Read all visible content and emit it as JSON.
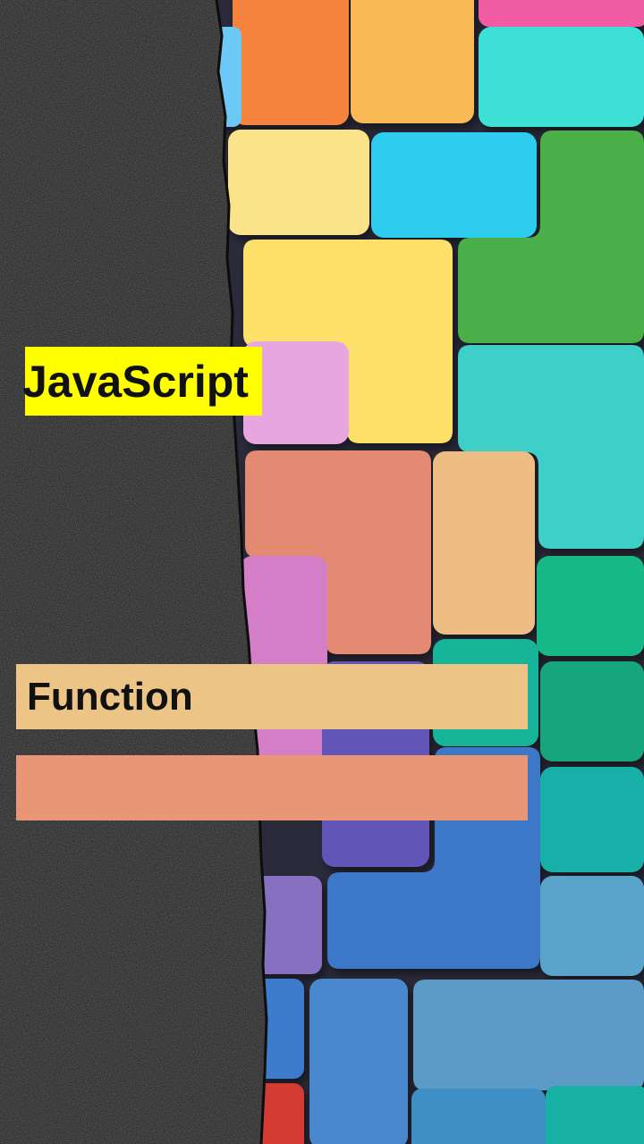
{
  "title": "JavaScript",
  "topic": "Function",
  "colors": {
    "title_badge": "#ffff00",
    "topic_bar": "#ecc486",
    "sub_bar": "#e89676",
    "panel": "#1a1a1a"
  }
}
